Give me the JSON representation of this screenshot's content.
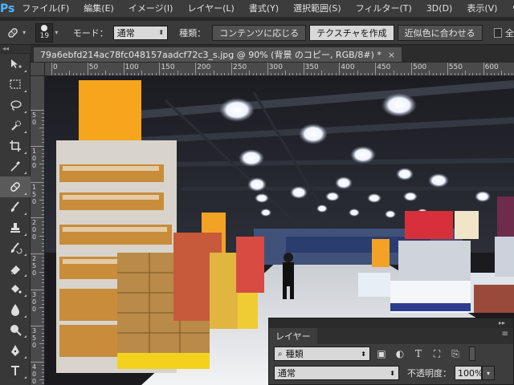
{
  "app": {
    "logo": "Ps"
  },
  "menu": [
    "ファイル(F)",
    "編集(E)",
    "イメージ(I)",
    "レイヤー(L)",
    "書式(Y)",
    "選択範囲(S)",
    "フィルター(T)",
    "3D(D)",
    "表示(V)",
    "ウィン"
  ],
  "options": {
    "tool_icon": "spot-healing-brush-icon",
    "brush_size": "19",
    "mode_label": "モード：",
    "mode_value": "通常",
    "type_label": "種類：",
    "type_options": [
      "コンテンツに応じる",
      "テクスチャを作成",
      "近似色に合わせる"
    ],
    "type_selected": "テクスチャを作成",
    "sample_all_label": "全"
  },
  "collapse_strip": "◂◂",
  "tools": [
    {
      "name": "move-tool-icon",
      "active": false
    },
    {
      "name": "marquee-tool-icon",
      "active": false
    },
    {
      "name": "lasso-tool-icon",
      "active": false
    },
    {
      "name": "quick-selection-tool-icon",
      "active": false
    },
    {
      "name": "crop-tool-icon",
      "active": false
    },
    {
      "name": "eyedropper-tool-icon",
      "active": false
    },
    {
      "name": "spot-healing-brush-icon",
      "active": true
    },
    {
      "name": "brush-tool-icon",
      "active": false
    },
    {
      "name": "clone-stamp-tool-icon",
      "active": false
    },
    {
      "name": "history-brush-tool-icon",
      "active": false
    },
    {
      "name": "eraser-tool-icon",
      "active": false
    },
    {
      "name": "paint-bucket-tool-icon",
      "active": false
    },
    {
      "name": "blur-tool-icon",
      "active": false
    },
    {
      "name": "dodge-tool-icon",
      "active": false
    },
    {
      "name": "pen-tool-icon",
      "active": false
    },
    {
      "name": "type-tool-icon",
      "active": false
    }
  ],
  "document": {
    "tab_title": "79a6ebfd214ac78fc048157aadcf72c3_s.jpg @ 90% (背景 のコピー, RGB/8#) *",
    "close": "×"
  },
  "ruler": {
    "h_labels": [
      "0",
      "50",
      "100",
      "150",
      "200",
      "250",
      "300",
      "350",
      "400",
      "450",
      "500",
      "550",
      "600"
    ],
    "v_labels": [
      "50",
      "100",
      "150",
      "200",
      "250",
      "300",
      "350",
      "400"
    ]
  },
  "layers_panel": {
    "tab_label": "レイヤー",
    "menu_icon": "panel-menu-icon",
    "gripper": "▸▸",
    "filter_kind": "種類",
    "filter_icons": [
      "image-filter-icon",
      "adjustment-filter-icon",
      "type-filter-icon",
      "shape-filter-icon",
      "smart-object-filter-icon"
    ],
    "blend_mode": "通常",
    "opacity_label": "不透明度：",
    "opacity_value": "100%"
  }
}
